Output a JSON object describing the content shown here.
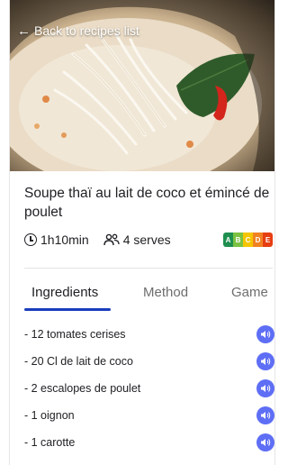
{
  "nav": {
    "back_label": "Back to recipes list",
    "back_icon": "arrow-left-icon"
  },
  "recipe": {
    "title": "Soupe thaï au lait de coco et émincé de poulet",
    "duration": "1h10min",
    "serves": "4 serves",
    "nutriscore": {
      "letters": [
        "A",
        "B",
        "C",
        "D",
        "E"
      ],
      "colors": [
        "#1e8f4e",
        "#7cc242",
        "#f5c500",
        "#f08223",
        "#e63e11"
      ]
    }
  },
  "tabs": [
    {
      "label": "Ingredients",
      "active": true
    },
    {
      "label": "Method",
      "active": false
    },
    {
      "label": "Game",
      "active": false
    }
  ],
  "ingredients": [
    "- 12 tomates cerises",
    "- 20 Cl de lait de coco",
    "- 2 escalopes de poulet",
    "- 1 oignon",
    "- 1 carotte"
  ],
  "colors": {
    "accent": "#1a3dbd",
    "speaker_button": "#5e6ef5"
  }
}
